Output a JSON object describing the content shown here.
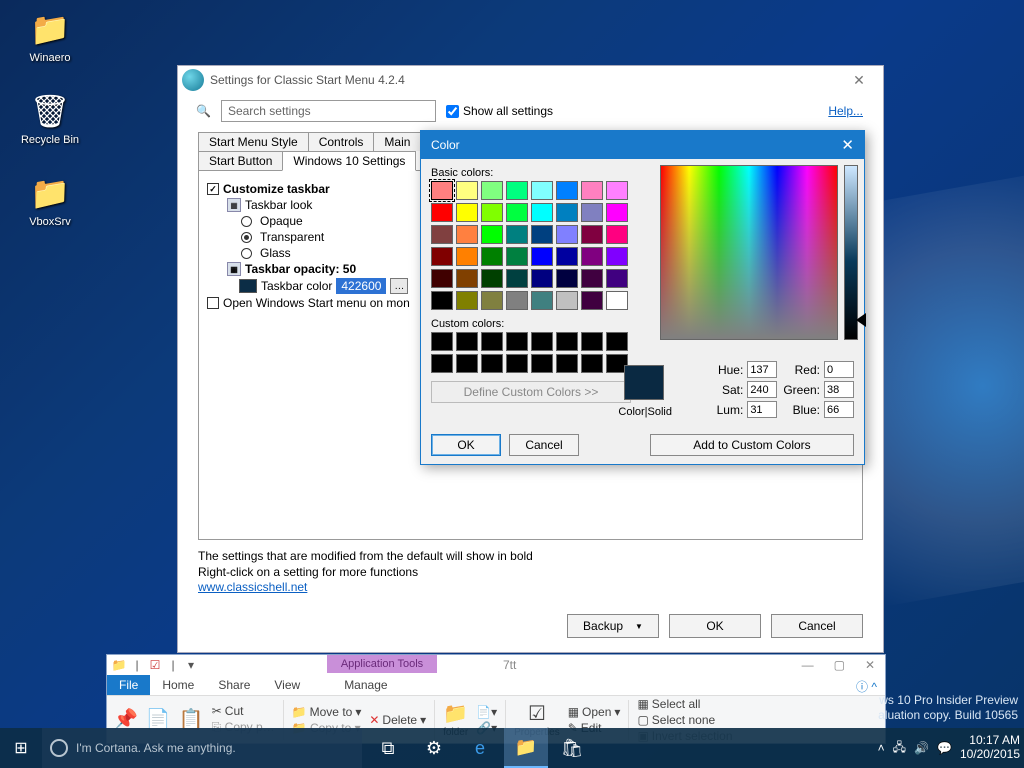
{
  "desktop": {
    "icons": [
      {
        "label": "Winaero",
        "glyph": "👤"
      },
      {
        "label": "Recycle Bin",
        "glyph": "🗑"
      },
      {
        "label": "VboxSrv",
        "glyph": "📁"
      }
    ]
  },
  "settingsWindow": {
    "title": "Settings for Classic Start Menu 4.2.4",
    "searchPlaceholder": "Search settings",
    "showAll": "Show all settings",
    "help": "Help...",
    "tabsRow1": [
      "Start Menu Style",
      "Controls",
      "Main"
    ],
    "tabsRow2": [
      "Start Button",
      "Windows 10 Settings"
    ],
    "tree": {
      "customize": "Customize taskbar",
      "look": "Taskbar look",
      "opaque": "Opaque",
      "transparent": "Transparent",
      "glass": "Glass",
      "opacity": "Taskbar opacity: 50",
      "colorLabel": "Taskbar color",
      "colorValue": "422600",
      "openWin": "Open Windows Start menu on mon"
    },
    "hint1": "The settings that are modified from the default will show in bold",
    "hint2": "Right-click on a setting for more functions",
    "link": "www.classicshell.net",
    "buttons": {
      "backup": "Backup",
      "ok": "OK",
      "cancel": "Cancel"
    }
  },
  "colorDialog": {
    "title": "Color",
    "basic": "Basic colors:",
    "custom": "Custom colors:",
    "define": "Define Custom Colors >>",
    "colorSolid": "Color|Solid",
    "labels": {
      "hue": "Hue:",
      "sat": "Sat:",
      "lum": "Lum:",
      "red": "Red:",
      "green": "Green:",
      "blue": "Blue:"
    },
    "values": {
      "hue": "137",
      "sat": "240",
      "lum": "31",
      "red": "0",
      "green": "38",
      "blue": "66"
    },
    "ok": "OK",
    "cancel": "Cancel",
    "add": "Add to Custom Colors",
    "basicColors": [
      "#ff8080",
      "#ffff80",
      "#80ff80",
      "#00ff80",
      "#80ffff",
      "#0080ff",
      "#ff80c0",
      "#ff80ff",
      "#ff0000",
      "#ffff00",
      "#80ff00",
      "#00ff40",
      "#00ffff",
      "#0080c0",
      "#8080c0",
      "#ff00ff",
      "#804040",
      "#ff8040",
      "#00ff00",
      "#008080",
      "#004080",
      "#8080ff",
      "#800040",
      "#ff0080",
      "#800000",
      "#ff8000",
      "#008000",
      "#008040",
      "#0000ff",
      "#0000a0",
      "#800080",
      "#8000ff",
      "#400000",
      "#804000",
      "#004000",
      "#004040",
      "#000080",
      "#000040",
      "#400040",
      "#400080",
      "#000000",
      "#808000",
      "#808040",
      "#808080",
      "#408080",
      "#c0c0c0",
      "#400040",
      "#ffffff"
    ]
  },
  "explorer": {
    "ctxTab": "Application Tools",
    "title": "7tt",
    "tabs": {
      "file": "File",
      "home": "Home",
      "share": "Share",
      "view": "View",
      "manage": "Manage"
    },
    "ribbon": {
      "cut": "Cut",
      "copyto": "Copy to",
      "moveto": "Move to",
      "delete": "Delete",
      "properties": "Properties",
      "open": "Open",
      "edit": "Edit",
      "selectall": "Select all",
      "selectnone": "Select none",
      "invert": "Invert selection"
    }
  },
  "taskbar": {
    "cortana": "I'm Cortana. Ask me anything.",
    "clock": {
      "time": "10:17 AM",
      "date": "10/20/2015"
    }
  },
  "watermark": {
    "l1": "ws 10 Pro Insider Preview",
    "l2": "aluation copy. Build 10565"
  }
}
